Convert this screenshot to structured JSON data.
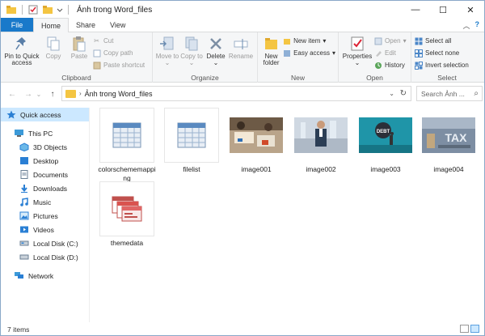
{
  "window": {
    "title": "Ảnh trong Word_files"
  },
  "window_controls": {
    "minimize": "—",
    "maximize": "☐",
    "close": "✕"
  },
  "tabs": [
    {
      "label": "File"
    },
    {
      "label": "Home"
    },
    {
      "label": "Share"
    },
    {
      "label": "View"
    }
  ],
  "ribbon": {
    "clipboard": {
      "label": "Clipboard",
      "pin": "Pin to Quick access",
      "copy": "Copy",
      "paste": "Paste",
      "cut": "Cut",
      "copy_path": "Copy path",
      "paste_shortcut": "Paste shortcut"
    },
    "organize": {
      "label": "Organize",
      "move_to": "Move to",
      "copy_to": "Copy to",
      "delete": "Delete",
      "rename": "Rename"
    },
    "new": {
      "label": "New",
      "new_folder": "New folder",
      "new_item": "New item",
      "easy_access": "Easy access"
    },
    "open": {
      "label": "Open",
      "properties": "Properties",
      "open": "Open",
      "edit": "Edit",
      "history": "History"
    },
    "select": {
      "label": "Select",
      "select_all": "Select all",
      "select_none": "Select none",
      "invert_selection": "Invert selection"
    }
  },
  "address": {
    "path": "Ảnh trong Word_files",
    "search_placeholder": "Search Ảnh ..."
  },
  "nav": [
    {
      "label": "Quick access",
      "icon": "star-icon"
    },
    {
      "label": "This PC",
      "icon": "pc-icon"
    },
    {
      "label": "3D Objects",
      "icon": "cube-icon"
    },
    {
      "label": "Desktop",
      "icon": "desktop-icon"
    },
    {
      "label": "Documents",
      "icon": "documents-icon"
    },
    {
      "label": "Downloads",
      "icon": "download-icon"
    },
    {
      "label": "Music",
      "icon": "music-icon"
    },
    {
      "label": "Pictures",
      "icon": "pictures-icon"
    },
    {
      "label": "Videos",
      "icon": "videos-icon"
    },
    {
      "label": "Local Disk (C:)",
      "icon": "disk-icon"
    },
    {
      "label": "Local Disk (D:)",
      "icon": "disk-icon"
    },
    {
      "label": "Network",
      "icon": "network-icon"
    }
  ],
  "files": [
    {
      "name": "colorschememapping",
      "kind": "xml"
    },
    {
      "name": "filelist",
      "kind": "xml"
    },
    {
      "name": "image001",
      "kind": "photo"
    },
    {
      "name": "image002",
      "kind": "photo"
    },
    {
      "name": "image003",
      "kind": "photo",
      "overlay": "DEBT"
    },
    {
      "name": "image004",
      "kind": "photo",
      "overlay": "TAX"
    },
    {
      "name": "themedata",
      "kind": "theme"
    }
  ],
  "status": {
    "item_count": "7 items"
  },
  "colors": {
    "accent": "#1979ca",
    "selection": "#cce8ff",
    "folder": "#f4c542"
  }
}
